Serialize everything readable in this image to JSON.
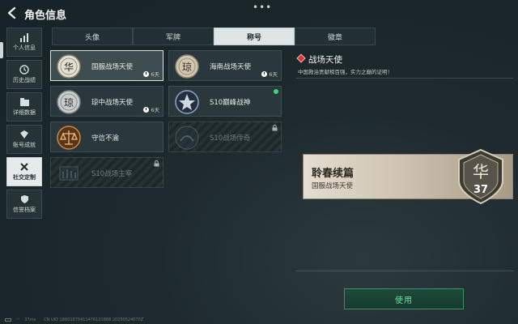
{
  "header": {
    "title": "角色信息",
    "more": "•••"
  },
  "sidebar": {
    "items": [
      {
        "label": "个人信息",
        "icon": "bar-chart-icon"
      },
      {
        "label": "历史战绩",
        "icon": "history-icon"
      },
      {
        "label": "详细数据",
        "icon": "data-folder-icon"
      },
      {
        "label": "账号成就",
        "icon": "achievement-icon"
      },
      {
        "label": "社交定制",
        "icon": "customize-tools-icon",
        "active": true
      },
      {
        "label": "信誉档案",
        "icon": "reputation-shield-icon"
      }
    ]
  },
  "tabs": [
    {
      "label": "头像"
    },
    {
      "label": "军牌"
    },
    {
      "label": "称号",
      "active": true
    },
    {
      "label": "徽章"
    }
  ],
  "titles": [
    {
      "name": "国服战场天使",
      "time": "6天",
      "selected": true,
      "locked": false,
      "new": false,
      "medal_char": "华"
    },
    {
      "name": "海南战场天使",
      "time": "6天",
      "selected": false,
      "locked": false,
      "new": false,
      "medal_char": "琼"
    },
    {
      "name": "琼中战场天使",
      "time": "6天",
      "selected": false,
      "locked": false,
      "new": false,
      "medal_char": "琼"
    },
    {
      "name": "S10巅峰战神",
      "time": "",
      "selected": false,
      "locked": false,
      "new": true,
      "medal_char": ""
    },
    {
      "name": "守信不渝",
      "time": "",
      "selected": false,
      "locked": false,
      "new": false,
      "medal_char": ""
    },
    {
      "name": "S10战场传奇",
      "time": "",
      "selected": false,
      "locked": true,
      "new": false,
      "medal_char": ""
    },
    {
      "name": "S10战场主宰",
      "time": "",
      "selected": false,
      "locked": true,
      "new": false,
      "medal_char": ""
    }
  ],
  "detail": {
    "title": "战场天使",
    "description": "中国救治贡献榜百强，实力之巅的证明！",
    "banner_name": "聆春续篇",
    "banner_sub": "国服战场天使",
    "emblem_char": "华",
    "emblem_number": "37",
    "use_button": "使用"
  },
  "status": {
    "ping": "37ms",
    "uid": "CN UID 18601870411476121868 20230524070Z"
  },
  "colors": {
    "accent_green": "#6fe3a6",
    "danger_red": "#d23a3a",
    "new_dot": "#3fd67a"
  }
}
